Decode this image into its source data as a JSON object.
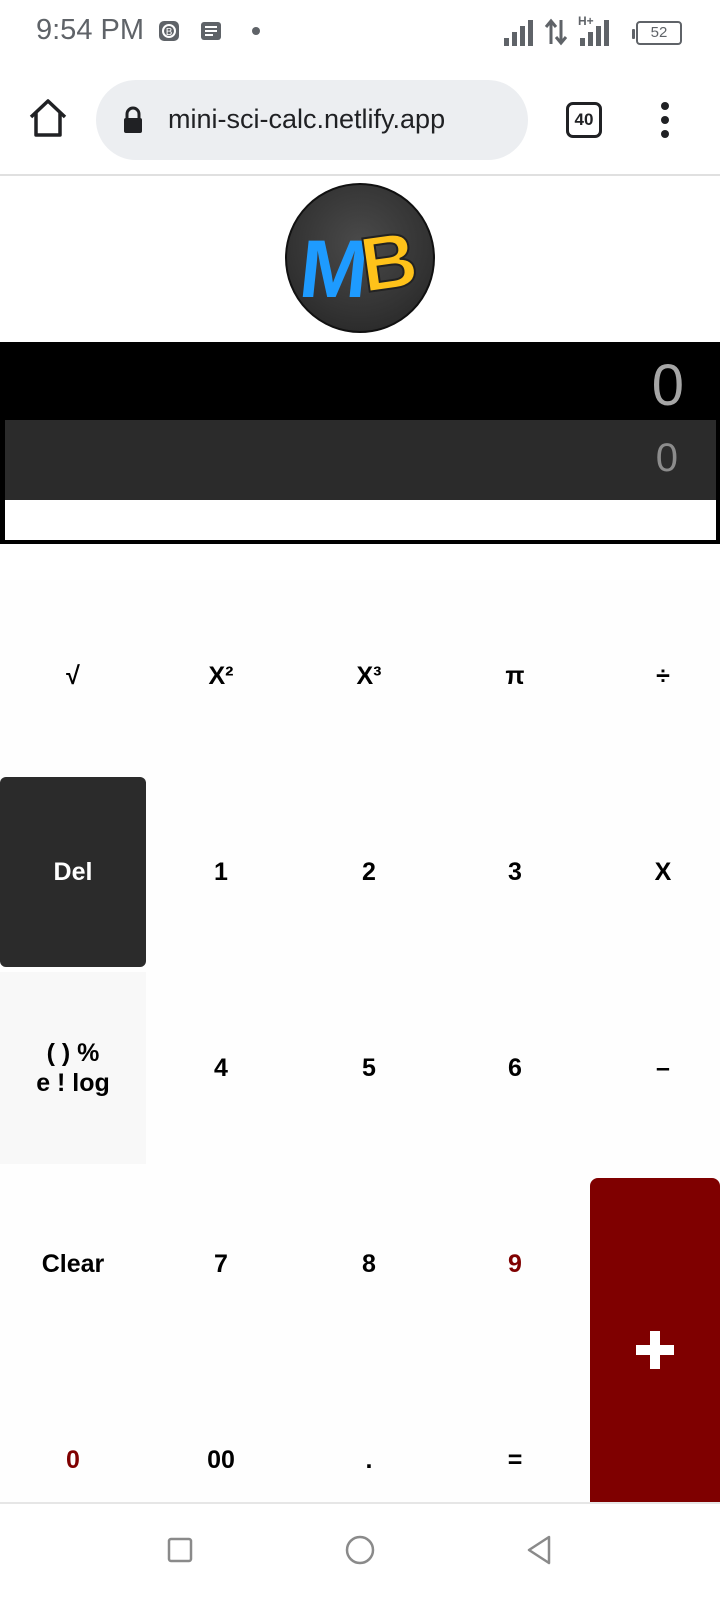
{
  "status_bar": {
    "time": "9:54 PM",
    "battery": "52",
    "network_label": "H+"
  },
  "browser": {
    "url": "mini-sci-calc.netlify.app",
    "tab_count": "40"
  },
  "logo": {
    "letters": "MB",
    "colors": {
      "m": "#1e9bff",
      "b": "#ffc21a"
    }
  },
  "display": {
    "main_value": "0",
    "sub_value": "0",
    "input_value": ""
  },
  "keypad": {
    "row1": [
      "√",
      "X²",
      "X³",
      "π",
      "÷"
    ],
    "row2": [
      "Del",
      "1",
      "2",
      "3",
      "X"
    ],
    "row3": [
      "( ) %\ne ! log",
      "4",
      "5",
      "6",
      "–"
    ],
    "row4": [
      "Clear",
      "7",
      "8",
      "9"
    ],
    "plus": "+",
    "row5": [
      "0",
      "00",
      ".",
      "="
    ]
  },
  "colors": {
    "accent_red": "#7f0000",
    "del_bg": "#2b2b2b",
    "display_bg": "#000000",
    "sub_display_bg": "#2b2b2b"
  }
}
